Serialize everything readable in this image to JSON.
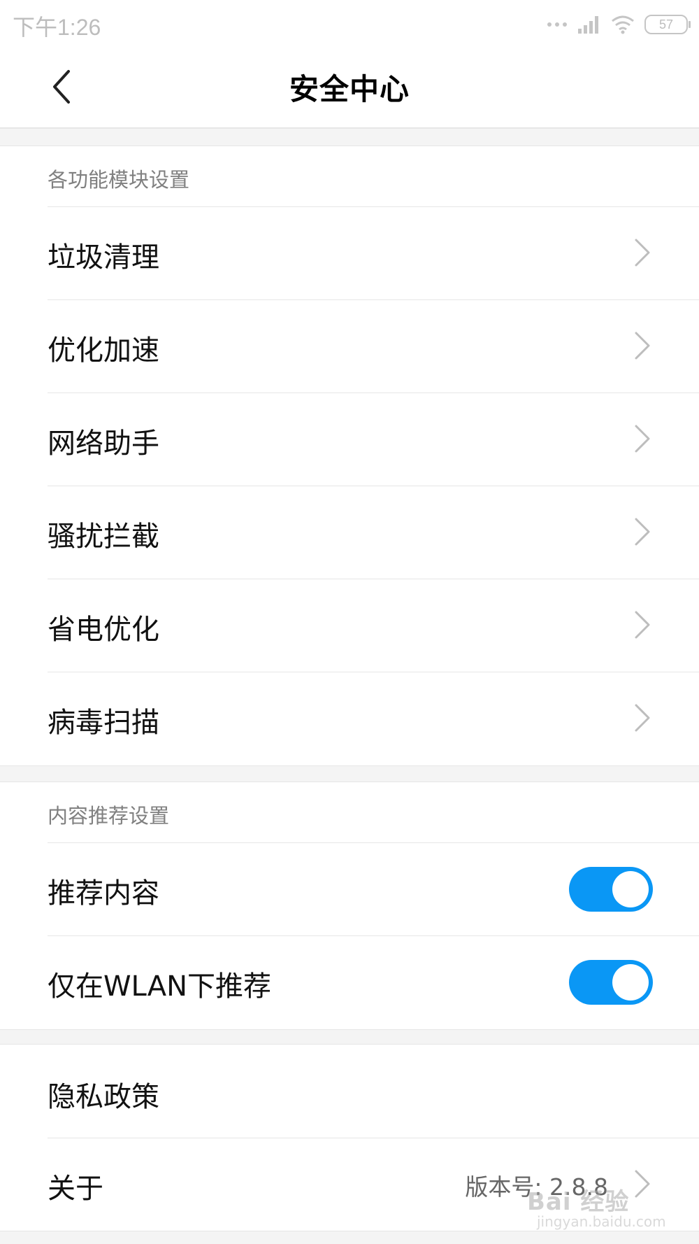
{
  "status_bar": {
    "time": "下午1:26",
    "battery": "57"
  },
  "header": {
    "title": "安全中心"
  },
  "section_modules": {
    "title": "各功能模块设置",
    "items": [
      {
        "label": "垃圾清理"
      },
      {
        "label": "优化加速"
      },
      {
        "label": "网络助手"
      },
      {
        "label": "骚扰拦截"
      },
      {
        "label": "省电优化"
      },
      {
        "label": "病毒扫描"
      }
    ]
  },
  "section_content": {
    "title": "内容推荐设置",
    "items": [
      {
        "label": "推荐内容",
        "enabled": true
      },
      {
        "label": "仅在WLAN下推荐",
        "enabled": true
      }
    ]
  },
  "section_other": {
    "privacy": "隐私政策",
    "about": "关于",
    "version": "版本号: 2.8.8"
  },
  "watermark": {
    "brand": "Bai 经验",
    "url": "jingyan.baidu.com"
  },
  "colors": {
    "accent": "#0a97f5",
    "divider": "#e6e6e6",
    "gap": "#f4f4f4"
  }
}
